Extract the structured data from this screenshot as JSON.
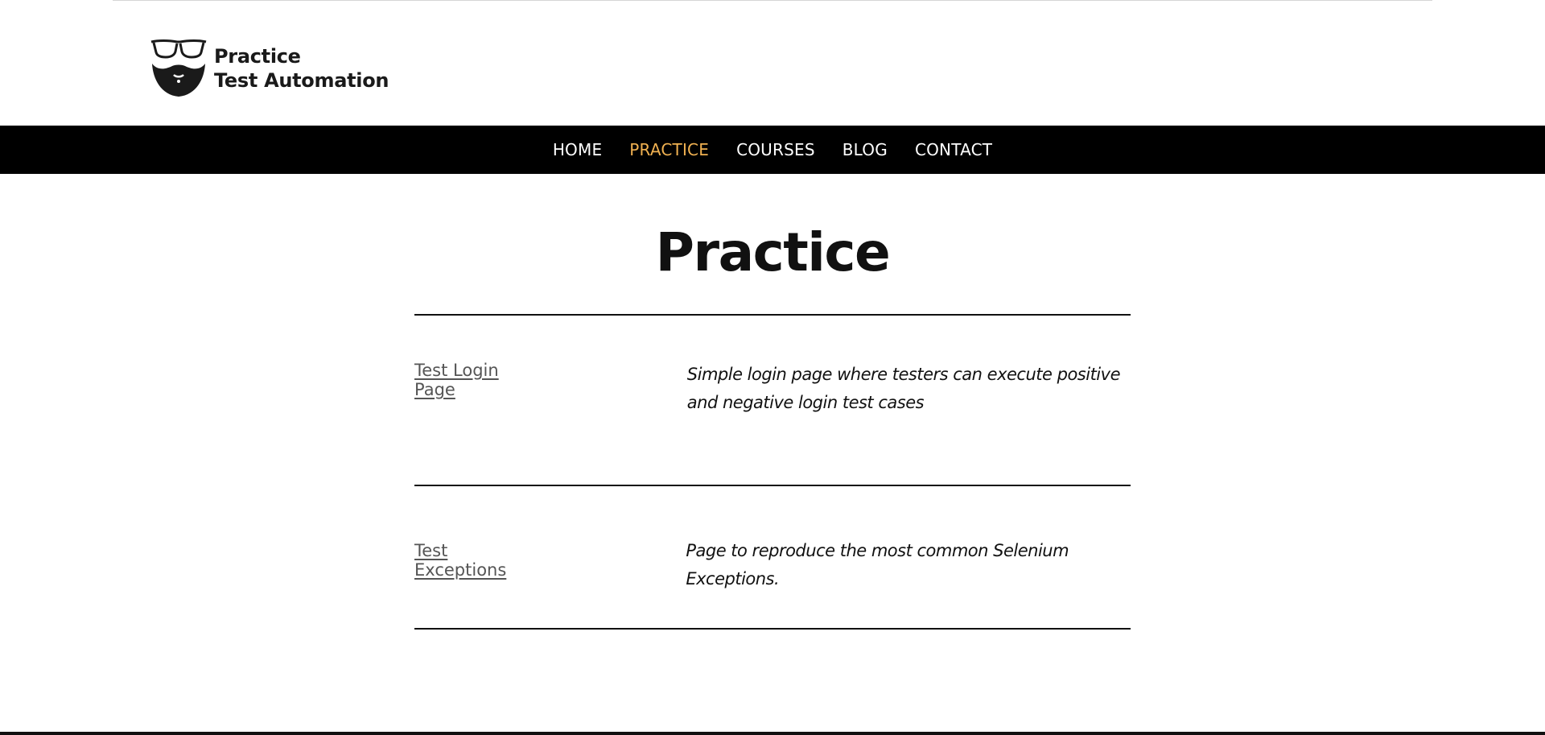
{
  "site": {
    "logo_line1": "Practice",
    "logo_line2": "Test Automation",
    "logo_icon": "glasses-beard-icon"
  },
  "nav": {
    "items": [
      {
        "label": "HOME",
        "active": false
      },
      {
        "label": "PRACTICE",
        "active": true
      },
      {
        "label": "COURSES",
        "active": false
      },
      {
        "label": "BLOG",
        "active": false
      },
      {
        "label": "CONTACT",
        "active": false
      }
    ],
    "active_color": "#f0b151",
    "background": "#000000"
  },
  "main": {
    "title": "Practice",
    "rows": [
      {
        "link": "Test Login Page",
        "description": "Simple login page where testers can execute positive and negative login test cases"
      },
      {
        "link": "Test Exceptions",
        "description": "Page to reproduce the most common Selenium Exceptions."
      }
    ]
  }
}
